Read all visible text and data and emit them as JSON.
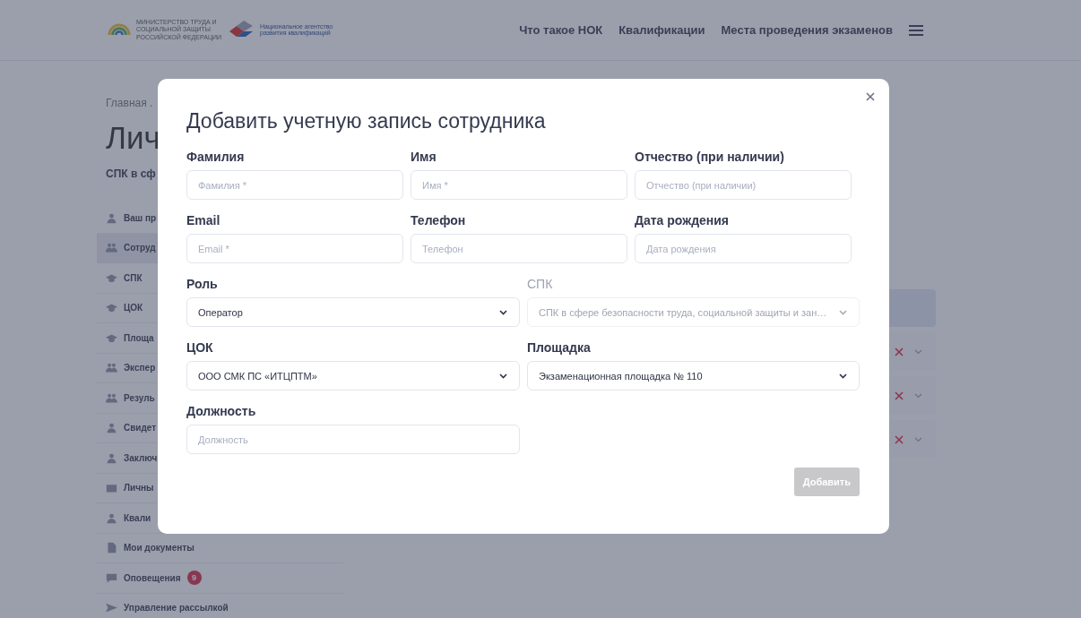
{
  "header": {
    "ministry_logo": "МИНИСТЕРСТВО ТРУДА И СОЦИАЛЬНОЙ ЗАЩИТЫ РОССИЙСКОЙ ФЕДЕРАЦИИ",
    "agency_logo": "Национальное агентство развития квалификаций",
    "nav": [
      "Что такое НОК",
      "Квалификации",
      "Места проведения экзаменов"
    ]
  },
  "breadcrumb": "Главная .",
  "page_title": "Лич",
  "subtitle": "СПК в сф",
  "sidebar": {
    "items": [
      {
        "label": "Ваш пр",
        "selected": false
      },
      {
        "label": "Сотруд",
        "selected": true
      },
      {
        "label": "СПК",
        "selected": false
      },
      {
        "label": "ЦОК",
        "selected": false
      },
      {
        "label": "Площа",
        "selected": false
      },
      {
        "label": "Экспер",
        "selected": false
      },
      {
        "label": "Резуль",
        "selected": false
      },
      {
        "label": "Свидет",
        "selected": false
      },
      {
        "label": "Заключ",
        "selected": false
      },
      {
        "label": "Личны",
        "selected": false
      },
      {
        "label": "Квали",
        "selected": false
      },
      {
        "label": "Мои документы",
        "selected": false
      },
      {
        "label": "Оповещения",
        "selected": false,
        "badge": "9"
      },
      {
        "label": "Управление рассылкой",
        "selected": false
      }
    ]
  },
  "modal": {
    "title": "Добавить учетную запись сотрудника",
    "rows": [
      {
        "fields": [
          {
            "label": "Фамилия",
            "kind": "input",
            "placeholder": "Фамилия *",
            "disabled": false
          },
          {
            "label": "Имя",
            "kind": "input",
            "placeholder": "Имя *",
            "disabled": false
          },
          {
            "label": "Отчество (при наличии)",
            "kind": "input",
            "placeholder": "Отчество (при наличии)",
            "disabled": false
          }
        ]
      },
      {
        "fields": [
          {
            "label": "Email",
            "kind": "input",
            "placeholder": "Email *",
            "disabled": false
          },
          {
            "label": "Телефон",
            "kind": "input",
            "placeholder": "Телефон",
            "disabled": false
          },
          {
            "label": "Дата рождения",
            "kind": "input",
            "placeholder": "Дата рождения",
            "disabled": false
          }
        ]
      },
      {
        "fields": [
          {
            "label": "Роль",
            "kind": "select",
            "value": "Оператор",
            "disabled": false
          },
          {
            "label": "СПК",
            "kind": "select",
            "value": "СПК в сфере безопасности труда, социальной защиты и зан…",
            "disabled": true
          }
        ]
      },
      {
        "fields": [
          {
            "label": "ЦОК",
            "kind": "select",
            "value": "ООО СМК ПС «ИТЦПТМ»",
            "disabled": false
          },
          {
            "label": "Площадка",
            "kind": "select",
            "value": "Экзаменационная площадка № 110",
            "disabled": false
          }
        ]
      },
      {
        "fields": [
          {
            "label": "Должность",
            "kind": "input",
            "placeholder": "Должность",
            "disabled": false
          }
        ]
      }
    ],
    "submit": {
      "label": "Добавить",
      "disabled": true
    }
  }
}
